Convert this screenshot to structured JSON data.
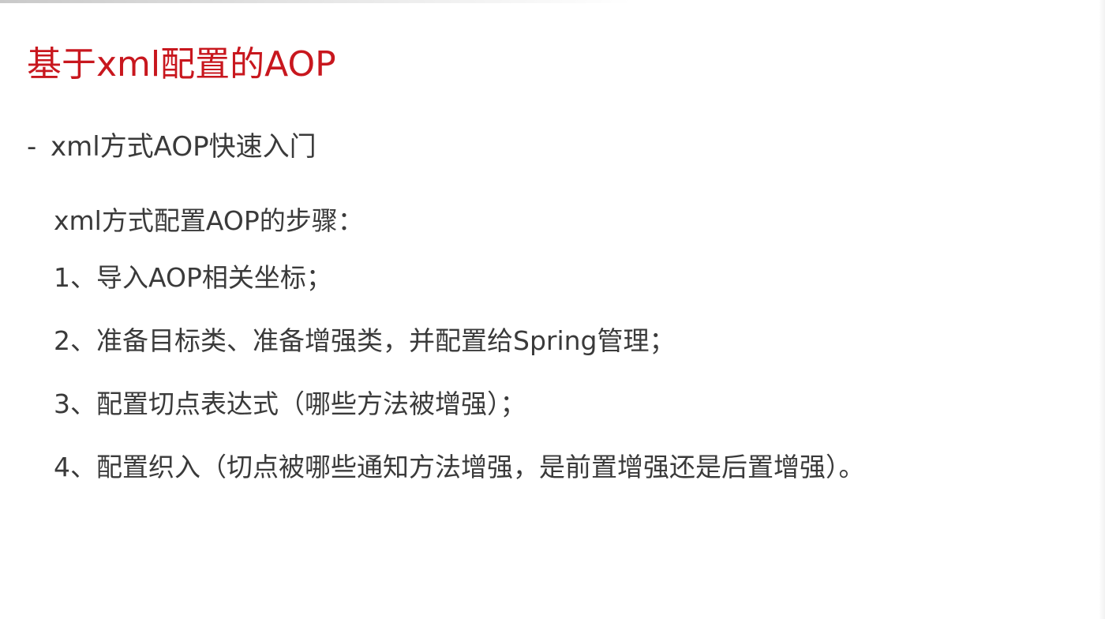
{
  "slide": {
    "title": "基于xml配置的AOP",
    "subtitle_dash": "-",
    "subtitle": "xml方式AOP快速入门",
    "steps_intro": "xml方式配置AOP的步骤：",
    "steps": [
      "1、导入AOP相关坐标；",
      "2、准备目标类、准备增强类，并配置给Spring管理；",
      "3、配置切点表达式（哪些方法被增强）；",
      "4、配置织入（切点被哪些通知方法增强，是前置增强还是后置增强）。"
    ]
  },
  "colors": {
    "title": "#c8171e",
    "body_text": "#3a3a3a",
    "background": "#ffffff"
  }
}
